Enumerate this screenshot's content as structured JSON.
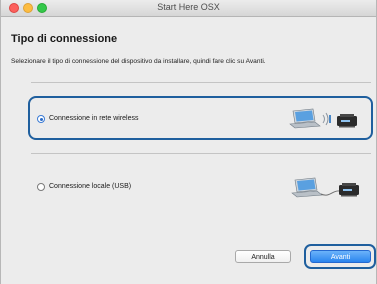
{
  "window": {
    "title": "Start Here OSX"
  },
  "page": {
    "title": "Tipo di connessione",
    "instructions": "Selezionare il tipo di connessione del dispositivo da installare, quindi fare clic su Avanti."
  },
  "options": [
    {
      "label": "Connessione in rete wireless",
      "selected": true,
      "icon": "laptop-wireless-printer-icon"
    },
    {
      "label": "Connessione locale (USB)",
      "selected": false,
      "icon": "laptop-usb-printer-icon"
    }
  ],
  "buttons": {
    "cancel": "Annulla",
    "next": "Avanti"
  },
  "colors": {
    "highlight": "#1f5f9e",
    "primary_button": "#2a85ee"
  }
}
